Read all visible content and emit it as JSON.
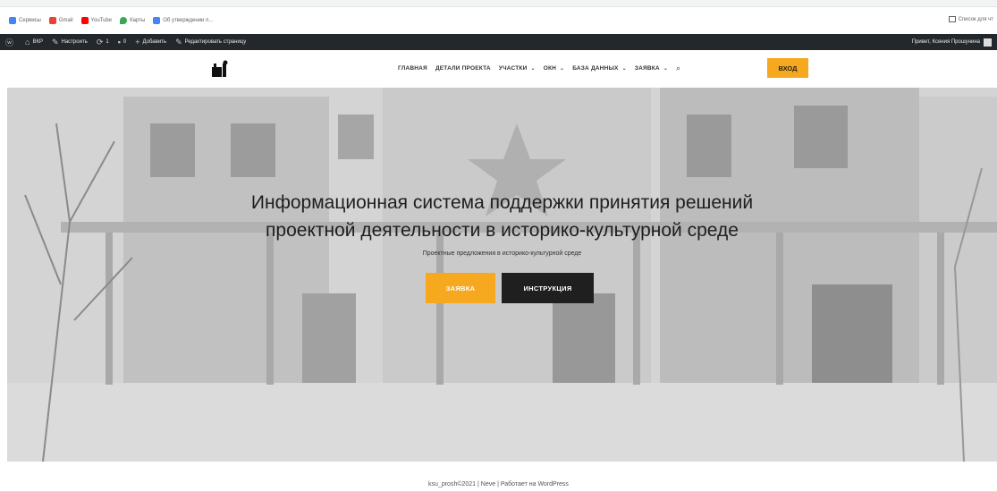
{
  "bookmarks": {
    "items": [
      {
        "label": "Сервисы",
        "color": "#4285f4"
      },
      {
        "label": "Gmail",
        "color": "#ea4335"
      },
      {
        "label": "YouTube",
        "color": "#ff0000"
      },
      {
        "label": "Карты",
        "color": "#34a853"
      },
      {
        "label": "Об утверждении п...",
        "color": "#4285f4"
      }
    ],
    "reading_list": "Список для чт"
  },
  "adminbar": {
    "site": "ВКР",
    "customize": "Настроить",
    "updates": "1",
    "comments": "0",
    "add_new": "Добавить",
    "edit_page": "Редактировать страницу",
    "greeting": "Привет, Ксения Прошунина"
  },
  "nav": {
    "items": [
      {
        "label": "ГЛАВНАЯ",
        "dropdown": false
      },
      {
        "label": "ДЕТАЛИ ПРОЕКТА",
        "dropdown": false
      },
      {
        "label": "УЧАСТКИ",
        "dropdown": true
      },
      {
        "label": "ОКН",
        "dropdown": true
      },
      {
        "label": "БАЗА ДАННЫХ",
        "dropdown": true
      },
      {
        "label": "ЗАЯВКА",
        "dropdown": true
      }
    ],
    "login": "ВХОД",
    "accent": "#f6a81f"
  },
  "hero": {
    "title_line1": "Информационная система поддержки принятия решений",
    "title_line2": "проектной деятельности в историко-культурной среде",
    "subtitle": "Проектные предложения в историко-культурной среде",
    "btn_apply": "ЗАЯВКА",
    "btn_guide": "ИНСТРУКЦИЯ"
  },
  "footer": {
    "text": "ksu_prosh©2021 | Neve | Работает на WordPress"
  }
}
